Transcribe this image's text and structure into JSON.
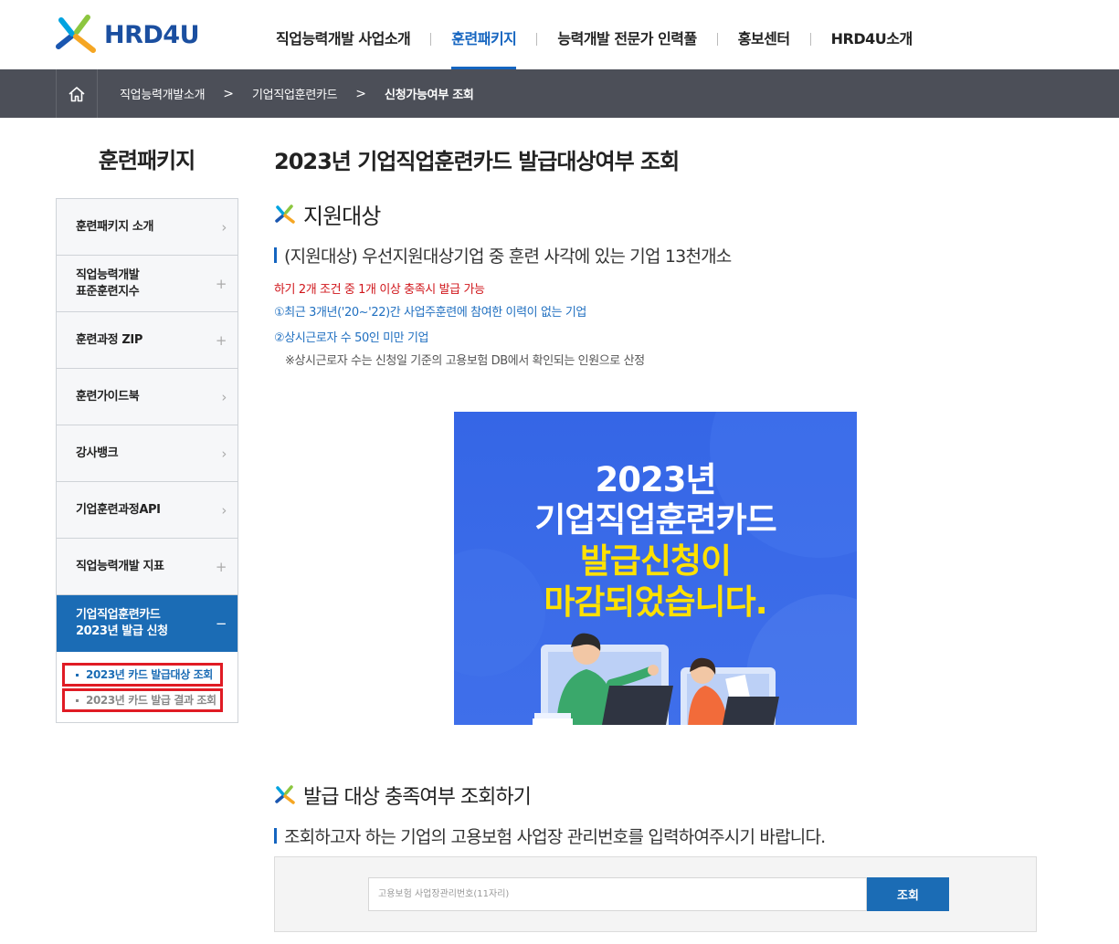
{
  "header": {
    "logo_text": "HRD4U",
    "nav": [
      {
        "label": "직업능력개발 사업소개",
        "active": false
      },
      {
        "label": "훈련패키지",
        "active": true
      },
      {
        "label": "능력개발 전문가 인력풀",
        "active": false
      },
      {
        "label": "홍보센터",
        "active": false
      },
      {
        "label": "HRD4U소개",
        "active": false
      }
    ]
  },
  "breadcrumb": {
    "items": [
      "직업능력개발소개",
      "기업직업훈련카드",
      "신청가능여부 조회"
    ],
    "separator": ">"
  },
  "sidebar": {
    "title": "훈련패키지",
    "items": [
      {
        "label": "훈련패키지 소개",
        "icon": "›"
      },
      {
        "label": "직업능력개발\n표준훈련지수",
        "icon": "+"
      },
      {
        "label": "훈련과정 ZIP",
        "icon": "+"
      },
      {
        "label": "훈련가이드북",
        "icon": "›"
      },
      {
        "label": "강사뱅크",
        "icon": "›"
      },
      {
        "label": "기업훈련과정API",
        "icon": "›"
      },
      {
        "label": "직업능력개발 지표",
        "icon": "+"
      },
      {
        "label": "기업직업훈련카드\n2023년 발급 신청",
        "icon": "−"
      }
    ],
    "subitems": [
      {
        "label": "2023년 카드 발급대상 조회"
      },
      {
        "label": "2023년 카드 발급 결과 조회"
      }
    ]
  },
  "main": {
    "title": "2023년 기업직업훈련카드 발급대상여부 조회",
    "section1": {
      "heading": "지원대상",
      "subheading": "(지원대상) 우선지원대상기업 중 훈련 사각에 있는 기업 13천개소",
      "condition": "하기 2개 조건 중 1개 이상 충족시 발급 가능",
      "items": [
        "①최근 3개년('20~'22)간 사업주훈련에 참여한 이력이 없는 기업",
        "②상시근로자 수 50인 미만 기업"
      ],
      "note": "※상시근로자 수는 신청일 기준의 고용보험 DB에서 확인되는 인원으로 산정"
    },
    "banner": {
      "lines": [
        "2023년",
        "기업직업훈련카드",
        "발급신청이",
        "마감되었습니다."
      ]
    },
    "section2": {
      "heading": "발급 대상 충족여부 조회하기",
      "subheading": "조회하고자 하는 기업의 고용보험 사업장 관리번호를 입력하여주시기 바랍니다."
    },
    "search": {
      "placeholder": "고용보험 사업장관리번호(11자리)",
      "value": "",
      "button_label": "조회"
    }
  },
  "colors": {
    "primary_blue": "#1b6cb5",
    "breadcrumb_bg": "#4c4f58",
    "alert_red": "#d0161b",
    "banner_blue": "#3566e6",
    "banner_yellow": "#ffe100"
  }
}
